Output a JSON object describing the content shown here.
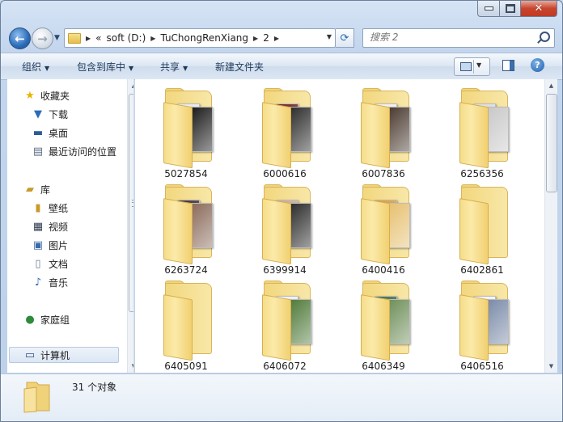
{
  "window": {
    "caption_buttons": [
      "minimize",
      "maximize",
      "close"
    ]
  },
  "navbar": {
    "breadcrumbs": [
      "soft (D:)",
      "TuChongRenXiang",
      "2"
    ],
    "overflow_marker": "«",
    "search_placeholder": "搜索 2"
  },
  "commandbar": {
    "organize": "组织",
    "include_in_library": "包含到库中",
    "share": "共享",
    "new_folder": "新建文件夹"
  },
  "navpane": {
    "favorites": {
      "label": "收藏夹",
      "items": [
        "下载",
        "桌面",
        "最近访问的位置"
      ]
    },
    "libraries": {
      "label": "库",
      "items": [
        "壁纸",
        "视频",
        "图片",
        "文档",
        "音乐"
      ]
    },
    "homegroup": "家庭组",
    "computer": "计算机"
  },
  "folders": [
    {
      "name": "5027854",
      "thumb": [
        "#e9e9e9",
        "#1a1a1a"
      ]
    },
    {
      "name": "6000616",
      "thumb": [
        "#6b1a1e",
        "#2b2b2b"
      ]
    },
    {
      "name": "6007836",
      "thumb": [
        "#f0f0f0",
        "#4a3a30"
      ]
    },
    {
      "name": "6256356",
      "thumb": [
        "#dcdcdc",
        "#c8c8c8"
      ]
    },
    {
      "name": "6263724",
      "thumb": [
        "#3a2a2a",
        "#8a6a5a"
      ]
    },
    {
      "name": "6399914",
      "thumb": [
        "#c8a890",
        "#2a2a2a"
      ]
    },
    {
      "name": "6400416",
      "thumb": [
        "#d99a30",
        "#e6c070"
      ]
    },
    {
      "name": "6402861",
      "thumb": []
    },
    {
      "name": "6405091",
      "thumb": []
    },
    {
      "name": "6406072",
      "thumb": [
        "#f0f0f0",
        "#4f7a3a"
      ]
    },
    {
      "name": "6406349",
      "thumb": [
        "#3e6a3a",
        "#6f8f5a"
      ]
    },
    {
      "name": "6406516",
      "thumb": [
        "#f4f4f4",
        "#7a8aa8"
      ]
    }
  ],
  "details": {
    "count_text": "31 个对象"
  }
}
